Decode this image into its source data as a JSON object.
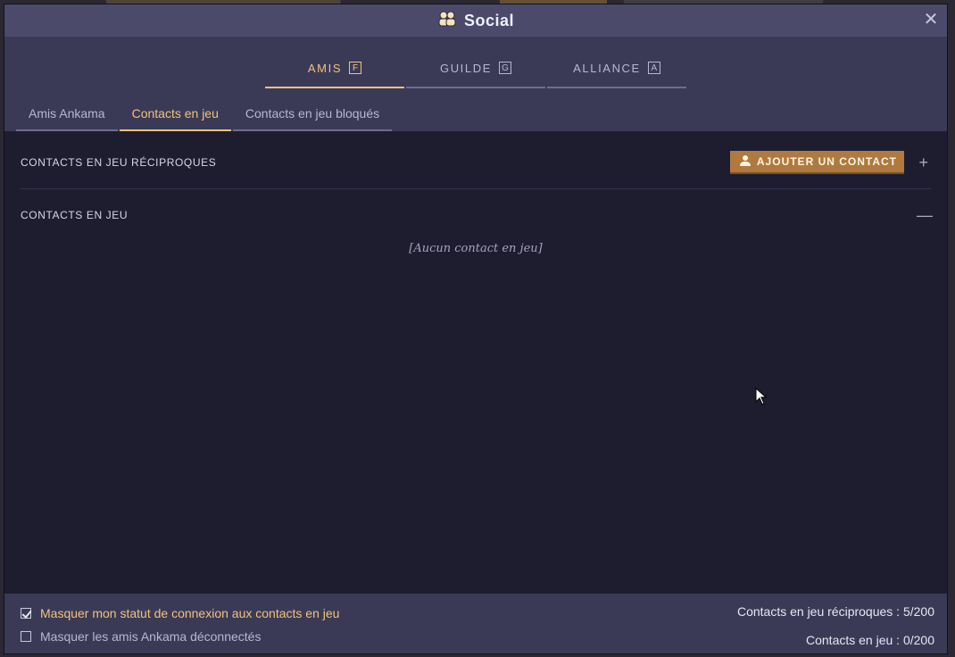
{
  "window": {
    "title": "Social",
    "close_label": "✕"
  },
  "main_tabs": [
    {
      "label": "AMIS",
      "key": "F",
      "active": true
    },
    {
      "label": "GUILDE",
      "key": "G",
      "active": false
    },
    {
      "label": "ALLIANCE",
      "key": "A",
      "active": false
    }
  ],
  "sub_tabs": [
    {
      "label": "Amis Ankama",
      "active": false
    },
    {
      "label": "Contacts en jeu",
      "active": true
    },
    {
      "label": "Contacts en jeu bloqués",
      "active": false
    }
  ],
  "sections": {
    "reciprocal": {
      "title": "CONTACTS EN JEU RÉCIPROQUES",
      "add_button": "AJOUTER UN CONTACT",
      "toggle": "+"
    },
    "contacts": {
      "title": "CONTACTS EN JEU",
      "toggle": "—",
      "empty_text": "[Aucun contact en jeu]"
    }
  },
  "footer": {
    "options": [
      {
        "label": "Masquer mon statut de connexion aux contacts en jeu",
        "checked": true
      },
      {
        "label": "Masquer les amis Ankama déconnectés",
        "checked": false
      }
    ],
    "counters": {
      "reciprocal": "Contacts en jeu réciproques : 5/200",
      "contacts": "Contacts en jeu : 0/200"
    }
  },
  "colors": {
    "accent": "#f0c27a",
    "button": "#b07a3e",
    "panel": "#1d1d2f",
    "header": "#3b3a56"
  }
}
